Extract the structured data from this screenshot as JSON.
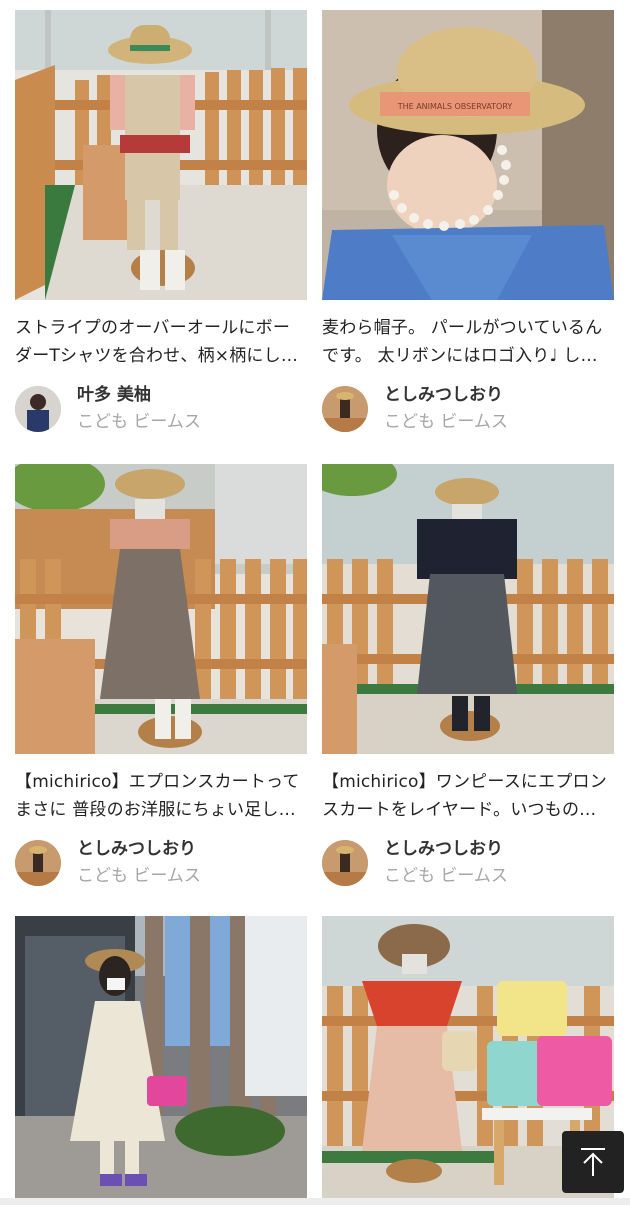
{
  "posts": [
    {
      "caption": "ストライプのオーバーオールにボーダーTシャツを合わせ、柄×柄にし…",
      "author_name": "叶多 美柚",
      "author_shop": "こども ビームス"
    },
    {
      "caption": "麦わら帽子。 パールがついているんです。 太リボンにはロゴ入り♩ し…",
      "author_name": "としみつしおり",
      "author_shop": "こども ビームス"
    },
    {
      "caption": "【michirico】エプロンスカートってまさに 普段のお洋服にちょい足し…",
      "author_name": "としみつしおり",
      "author_shop": "こども ビームス"
    },
    {
      "caption": "【michirico】ワンピースにエプロンスカートをレイヤード。いつもの…",
      "author_name": "としみつしおり",
      "author_shop": "こども ビームス"
    },
    {
      "caption": "",
      "author_name": "",
      "author_shop": ""
    },
    {
      "caption": "",
      "author_name": "",
      "author_shop": ""
    }
  ],
  "hat_label": "THE ANIMALS OBSERVATORY",
  "icons": {
    "scroll_top": "arrow-up-to-top-icon"
  },
  "colors": {
    "scroll_top_bg": "#222222",
    "author_shop_text": "#a6a6a6"
  }
}
